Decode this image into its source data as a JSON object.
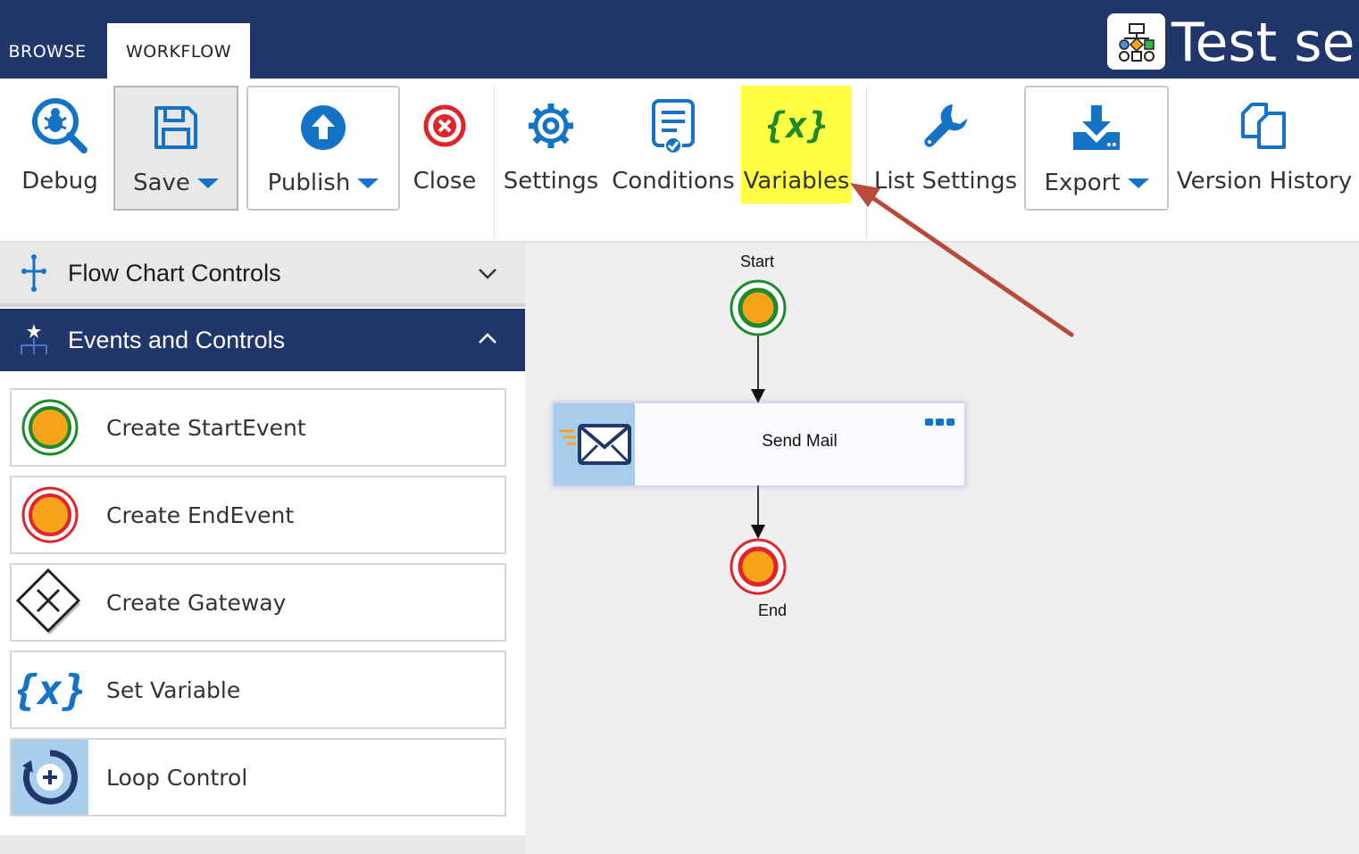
{
  "tabs": {
    "browse": "BROWSE",
    "workflow": "WORKFLOW"
  },
  "app": {
    "title": "Test ser"
  },
  "ribbon": {
    "debug": "Debug",
    "save": "Save",
    "publish": "Publish",
    "close": "Close",
    "settings": "Settings",
    "conditions": "Conditions",
    "variables": "Variables",
    "list_settings": "List Settings",
    "export": "Export",
    "version_history": "Version History"
  },
  "panel": {
    "flow_chart_controls": "Flow Chart Controls",
    "events_and_controls": "Events and Controls",
    "items": [
      {
        "label": "Create StartEvent",
        "icon": "start-event-icon"
      },
      {
        "label": "Create EndEvent",
        "icon": "end-event-icon"
      },
      {
        "label": "Create Gateway",
        "icon": "gateway-icon"
      },
      {
        "label": "Set Variable",
        "icon": "variable-icon"
      },
      {
        "label": "Loop Control",
        "icon": "loop-icon"
      }
    ]
  },
  "canvas": {
    "start_label": "Start",
    "task_label": "Send Mail",
    "end_label": "End"
  },
  "colors": {
    "header": "#21366b",
    "accent": "#1473c6",
    "highlight": "#ffff44",
    "annotation_arrow": "#b84a3a",
    "start_ring": "#1e8a2a",
    "end_ring": "#e0242a",
    "event_fill": "#f7a41b"
  }
}
